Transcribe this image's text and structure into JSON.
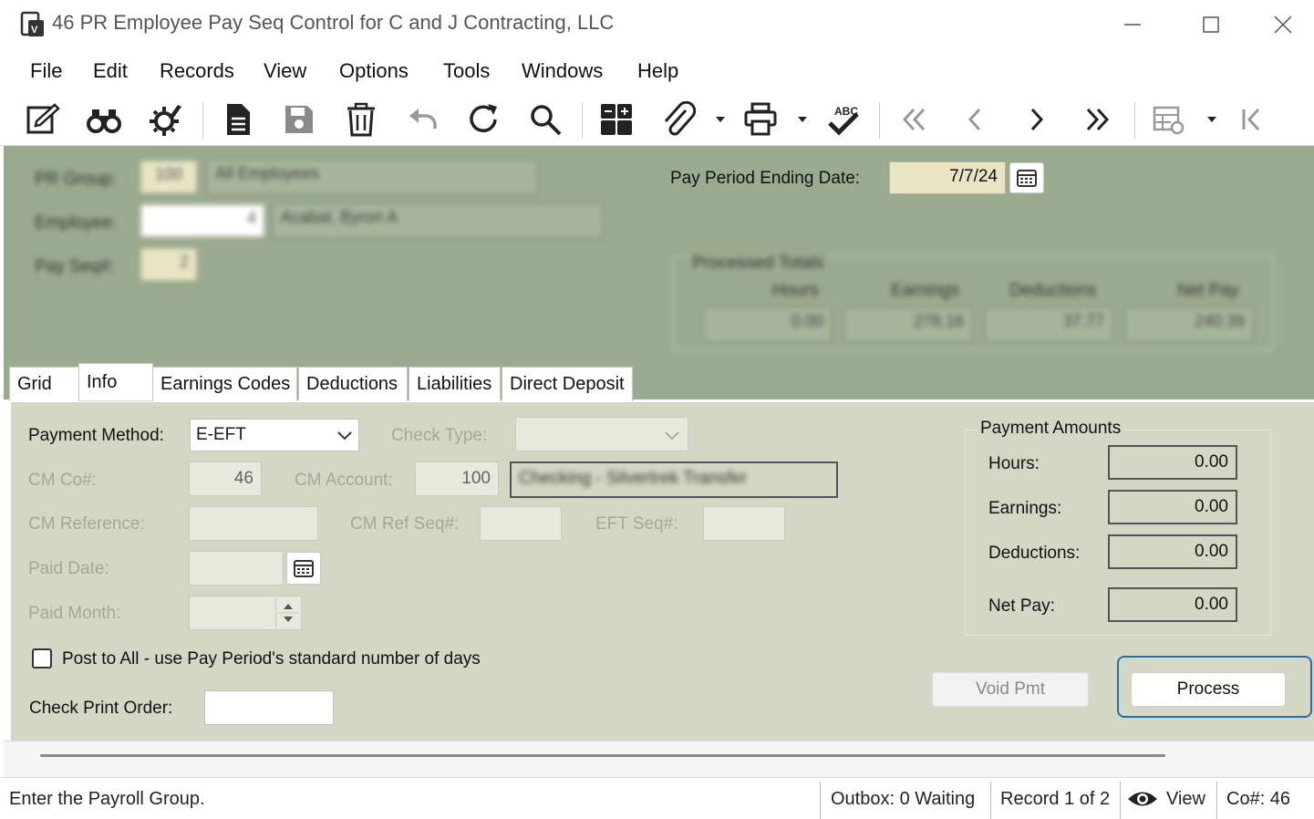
{
  "window": {
    "title": "46 PR Employee Pay Seq Control for C and J Contracting, LLC"
  },
  "menu": [
    "File",
    "Edit",
    "Records",
    "View",
    "Options",
    "Tools",
    "Windows",
    "Help"
  ],
  "toolbar_icons": [
    "edit-form-icon",
    "binoculars-icon",
    "settings-gear-icon",
    "new-document-icon",
    "save-icon",
    "delete-trash-icon",
    "undo-icon",
    "refresh-icon",
    "search-icon",
    "grid-calc-icon",
    "attachment-icon",
    "print-icon",
    "spellcheck-icon",
    "first-record-icon",
    "previous-record-icon",
    "next-record-icon",
    "last-record-icon",
    "grid-settings-icon",
    "go-to-start-icon"
  ],
  "header": {
    "pr_group_label": "PR Group:",
    "pr_group_value": "100",
    "pr_group_desc": "All Employees",
    "employee_label": "Employee:",
    "employee_value": "4",
    "employee_name": "Acabal, Byron A",
    "payseq_label": "Pay Seq#:",
    "payseq_value": "2",
    "pay_period_label": "Pay Period Ending Date:",
    "pay_period_value": "7/7/24",
    "processed_totals": {
      "title": "Processed Totals",
      "hours_label": "Hours",
      "earnings_label": "Earnings",
      "deductions_label": "Deductions",
      "netpay_label": "Net Pay",
      "hours": "0.00",
      "earnings": "278.16",
      "deductions": "37.77",
      "netpay": "240.39"
    }
  },
  "tabs": [
    {
      "label": "Grid"
    },
    {
      "label": "Info"
    },
    {
      "label": "Earnings Codes"
    },
    {
      "label": "Deductions"
    },
    {
      "label": "Liabilities"
    },
    {
      "label": "Direct Deposit"
    }
  ],
  "info": {
    "payment_method_label": "Payment Method:",
    "payment_method_value": "E-EFT",
    "check_type_label": "Check Type:",
    "check_type_value": "",
    "cm_co_label": "CM Co#:",
    "cm_co_value": "46",
    "cm_account_label": "CM Account:",
    "cm_account_value": "100",
    "cm_account_desc": "Checking - Silvertrek Transfer",
    "cm_reference_label": "CM Reference:",
    "cm_refseq_label": "CM Ref Seq#:",
    "eft_seq_label": "EFT Seq#:",
    "paid_date_label": "Paid Date:",
    "paid_month_label": "Paid Month:",
    "post_to_all_label": "Post to All - use Pay Period's standard number of days",
    "check_print_order_label": "Check Print Order:"
  },
  "payment_amounts": {
    "title": "Payment Amounts",
    "hours_label": "Hours:",
    "hours": "0.00",
    "earnings_label": "Earnings:",
    "earnings": "0.00",
    "deductions_label": "Deductions:",
    "deductions": "0.00",
    "netpay_label": "Net Pay:",
    "netpay": "0.00"
  },
  "buttons": {
    "void_pmt": "Void Pmt",
    "process": "Process"
  },
  "status": {
    "message": "Enter the Payroll Group.",
    "outbox": "Outbox: 0 Waiting",
    "record": "Record 1 of 2",
    "view": "View",
    "company": "Co#: 46"
  },
  "colors": {
    "header_bg": "#9bab8f",
    "content_bg": "#d3d8c4",
    "date_field_bg": "#e9e5c4",
    "focus_ring": "#2b6cb0"
  }
}
